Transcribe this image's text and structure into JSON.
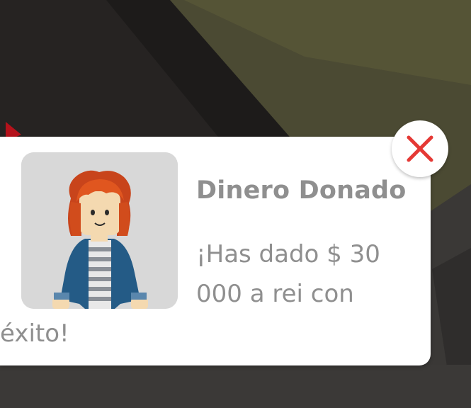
{
  "notification": {
    "title": "Dinero Donado",
    "message": "¡Has dado $ 30 000 a rei con éxito!"
  },
  "colors": {
    "panel": "#ffffff",
    "text": "#8f8f8f",
    "close_icon": "#e53935",
    "avatar_bg": "#d8d8d8"
  },
  "icons": {
    "close": "close-icon",
    "avatar": "player-avatar"
  }
}
